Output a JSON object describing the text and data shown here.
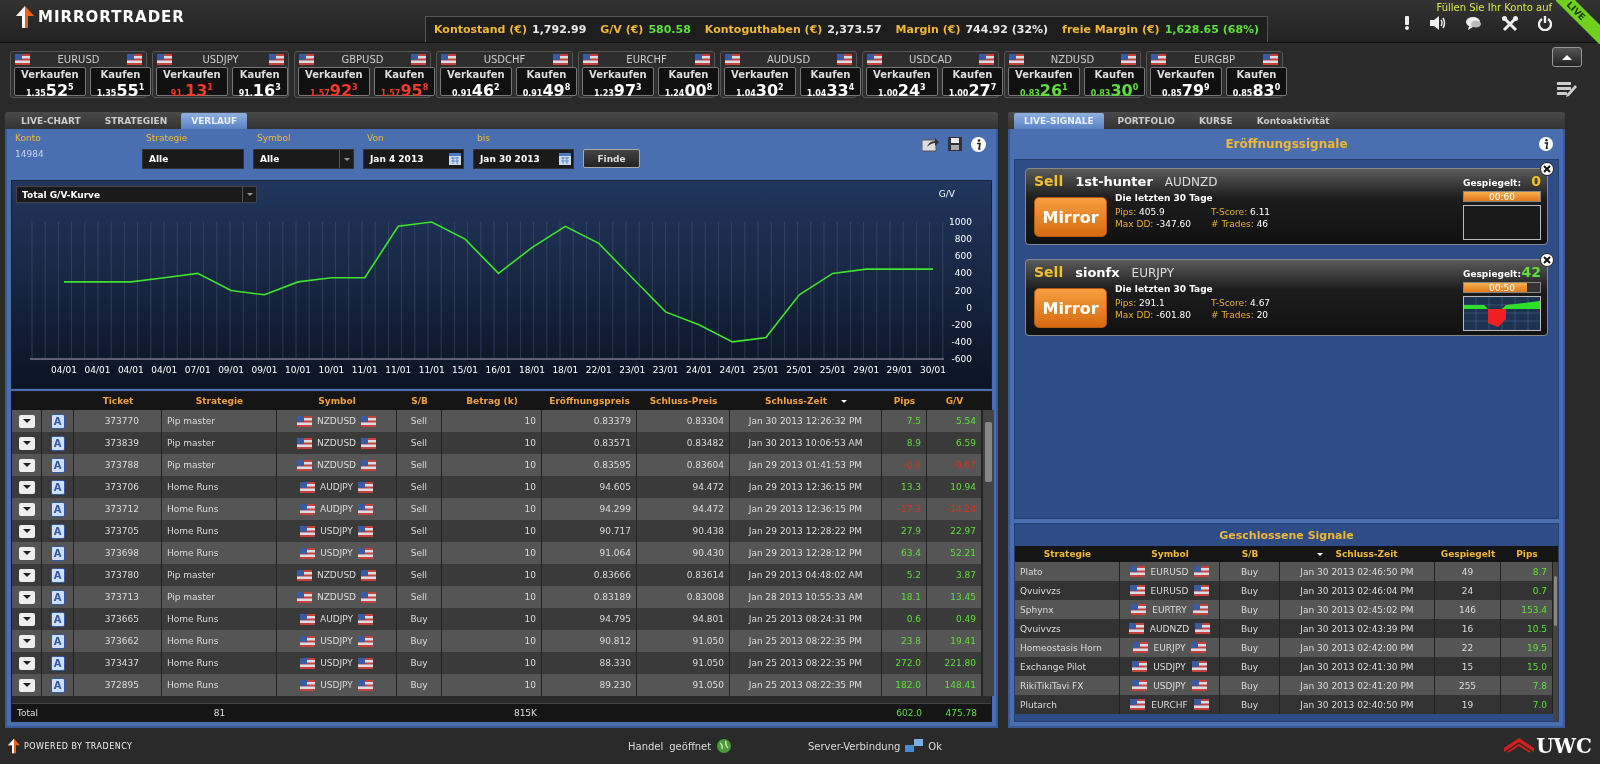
{
  "header": {
    "logo": "MIRRORTRADER",
    "account": [
      {
        "label": "Kontostand (€)",
        "value": "1,792.99",
        "positive": false
      },
      {
        "label": "G/V (€)",
        "value": "580.58",
        "positive": true
      },
      {
        "label": "Kontoguthaben (€)",
        "value": "2,373.57",
        "positive": false
      },
      {
        "label": "Margin (€)",
        "value": "744.92 (32%)",
        "positive": false
      },
      {
        "label": "freie Margin (€)",
        "value": "1,628.65 (68%)",
        "positive": true
      }
    ],
    "topup_link": "Füllen Sie Ihr Konto auf",
    "live_badge": "LIVE"
  },
  "quotes": [
    {
      "symbol": "EURUSD",
      "sell_label": "Verkaufen",
      "buy_label": "Kaufen",
      "sell": {
        "prefix": "1.35",
        "big": "52",
        "pip": "5",
        "color": "#ffffff"
      },
      "buy": {
        "prefix": "1.35",
        "big": "55",
        "pip": "1",
        "color": "#ffffff"
      }
    },
    {
      "symbol": "USDJPY",
      "sell_label": "Verkaufen",
      "buy_label": "Kaufen",
      "sell": {
        "prefix": "91.",
        "big": "13",
        "pip": "1",
        "color": "#f03a2a"
      },
      "buy": {
        "prefix": "91.",
        "big": "16",
        "pip": "3",
        "color": "#ffffff"
      }
    },
    {
      "symbol": "GBPUSD",
      "sell_label": "Verkaufen",
      "buy_label": "Kaufen",
      "sell": {
        "prefix": "1.57",
        "big": "92",
        "pip": "3",
        "color": "#f03a2a"
      },
      "buy": {
        "prefix": "1.57",
        "big": "95",
        "pip": "8",
        "color": "#f03a2a"
      }
    },
    {
      "symbol": "USDCHF",
      "sell_label": "Verkaufen",
      "buy_label": "Kaufen",
      "sell": {
        "prefix": "0.91",
        "big": "46",
        "pip": "2",
        "color": "#ffffff"
      },
      "buy": {
        "prefix": "0.91",
        "big": "49",
        "pip": "8",
        "color": "#ffffff"
      }
    },
    {
      "symbol": "EURCHF",
      "sell_label": "Verkaufen",
      "buy_label": "Kaufen",
      "sell": {
        "prefix": "1.23",
        "big": "97",
        "pip": "3",
        "color": "#ffffff"
      },
      "buy": {
        "prefix": "1.24",
        "big": "00",
        "pip": "8",
        "color": "#ffffff"
      }
    },
    {
      "symbol": "AUDUSD",
      "sell_label": "Verkaufen",
      "buy_label": "Kaufen",
      "sell": {
        "prefix": "1.04",
        "big": "30",
        "pip": "2",
        "color": "#ffffff"
      },
      "buy": {
        "prefix": "1.04",
        "big": "33",
        "pip": "4",
        "color": "#ffffff"
      }
    },
    {
      "symbol": "USDCAD",
      "sell_label": "Verkaufen",
      "buy_label": "Kaufen",
      "sell": {
        "prefix": "1.00",
        "big": "24",
        "pip": "3",
        "color": "#ffffff"
      },
      "buy": {
        "prefix": "1.00",
        "big": "27",
        "pip": "7",
        "color": "#ffffff"
      }
    },
    {
      "symbol": "NZDUSD",
      "sell_label": "Verkaufen",
      "buy_label": "Kaufen",
      "sell": {
        "prefix": "0.83",
        "big": "26",
        "pip": "1",
        "color": "#5de03a"
      },
      "buy": {
        "prefix": "0.83",
        "big": "30",
        "pip": "0",
        "color": "#5de03a"
      }
    },
    {
      "symbol": "EURGBP",
      "sell_label": "Verkaufen",
      "buy_label": "Kaufen",
      "sell": {
        "prefix": "0.85",
        "big": "79",
        "pip": "9",
        "color": "#ffffff"
      },
      "buy": {
        "prefix": "0.85",
        "big": "83",
        "pip": "0",
        "color": "#ffffff"
      }
    }
  ],
  "left_panel": {
    "tabs": [
      {
        "label": "LIVE-CHART",
        "selected": false
      },
      {
        "label": "STRATEGIEN",
        "selected": false
      },
      {
        "label": "VERLAUF",
        "selected": true
      }
    ],
    "filters": {
      "konto_label": "Konto",
      "konto": "14984",
      "strategie_label": "Strategie",
      "strategie": "Alle",
      "symbol_label": "Symbol",
      "symbol": "Alle",
      "von_label": "Von",
      "von": "Jan 4 2013",
      "bis_label": "bis",
      "bis": "Jan 30 2013",
      "find_button": "Finde"
    },
    "chart": {
      "selector": "Total G/V-Kurve",
      "chart_data": {
        "type": "line",
        "ylabel": "G/V",
        "categories": [
          "04/01",
          "04/01",
          "04/01",
          "04/01",
          "07/01",
          "09/01",
          "09/01",
          "10/01",
          "10/01",
          "11/01",
          "11/01",
          "11/01",
          "15/01",
          "16/01",
          "18/01",
          "18/01",
          "22/01",
          "23/01",
          "23/01",
          "24/01",
          "24/01",
          "25/01",
          "25/01",
          "25/01",
          "29/01",
          "29/01",
          "30/01"
        ],
        "series": [
          {
            "color": "#3ee52a",
            "values": [
              300,
              300,
              300,
              350,
              400,
              200,
              150,
              300,
              350,
              350,
              950,
              1000,
              800,
              400,
              700,
              950,
              750,
              350,
              -50,
              -200,
              -400,
              -350,
              150,
              400,
              450,
              450,
              450
            ]
          }
        ],
        "ylim": [
          -600,
          1000
        ],
        "yticks": [
          -600,
          -400,
          -200,
          0,
          200,
          400,
          600,
          800,
          1000
        ],
        "grid": true
      }
    },
    "trades": {
      "columns": [
        "Ticket",
        "Strategie",
        "Symbol",
        "S/B",
        "Betrag (k)",
        "Eröffnungspreis",
        "Schluss-Preis",
        "Schluss-Zeit",
        "Pips",
        "G/V"
      ],
      "rows": [
        {
          "badge": "A",
          "ticket": "373770",
          "strategy": "Pip master",
          "symbol": "NZDUSD",
          "side": "Sell",
          "amount": "10",
          "open": "0.83379",
          "close": "0.83304",
          "time": "Jan 30 2013 12:26:32 PM",
          "pips": "7.5",
          "pl": "5.54",
          "loss": false
        },
        {
          "badge": "A",
          "ticket": "373839",
          "strategy": "Pip master",
          "symbol": "NZDUSD",
          "side": "Sell",
          "amount": "10",
          "open": "0.83571",
          "close": "0.83482",
          "time": "Jan 30 2013 10:06:53 AM",
          "pips": "8.9",
          "pl": "6.59",
          "loss": false
        },
        {
          "badge": "A",
          "ticket": "373788",
          "strategy": "Pip master",
          "symbol": "NZDUSD",
          "side": "Sell",
          "amount": "10",
          "open": "0.83595",
          "close": "0.83604",
          "time": "Jan 29 2013 01:41:53 PM",
          "pips": "-0.9",
          "pl": "-0.67",
          "loss": true
        },
        {
          "badge": "A",
          "ticket": "373706",
          "strategy": "Home Runs",
          "symbol": "AUDJPY",
          "side": "Sell",
          "amount": "10",
          "open": "94.605",
          "close": "94.472",
          "time": "Jan 29 2013 12:36:15 PM",
          "pips": "13.3",
          "pl": "10.94",
          "loss": false
        },
        {
          "badge": "A",
          "ticket": "373712",
          "strategy": "Home Runs",
          "symbol": "AUDJPY",
          "side": "Sell",
          "amount": "10",
          "open": "94.299",
          "close": "94.472",
          "time": "Jan 29 2013 12:36:15 PM",
          "pips": "-17.3",
          "pl": "-14.24",
          "loss": true
        },
        {
          "badge": "A",
          "ticket": "373705",
          "strategy": "Home Runs",
          "symbol": "USDJPY",
          "side": "Sell",
          "amount": "10",
          "open": "90.717",
          "close": "90.438",
          "time": "Jan 29 2013 12:28:22 PM",
          "pips": "27.9",
          "pl": "22.97",
          "loss": false
        },
        {
          "badge": "A",
          "ticket": "373698",
          "strategy": "Home Runs",
          "symbol": "USDJPY",
          "side": "Sell",
          "amount": "10",
          "open": "91.064",
          "close": "90.430",
          "time": "Jan 29 2013 12:28:12 PM",
          "pips": "63.4",
          "pl": "52.21",
          "loss": false
        },
        {
          "badge": "A",
          "ticket": "373780",
          "strategy": "Pip master",
          "symbol": "NZDUSD",
          "side": "Sell",
          "amount": "10",
          "open": "0.83666",
          "close": "0.83614",
          "time": "Jan 29 2013 04:48:02 AM",
          "pips": "5.2",
          "pl": "3.87",
          "loss": false
        },
        {
          "badge": "A",
          "ticket": "373713",
          "strategy": "Pip master",
          "symbol": "NZDUSD",
          "side": "Sell",
          "amount": "10",
          "open": "0.83189",
          "close": "0.83008",
          "time": "Jan 28 2013 10:55:33 AM",
          "pips": "18.1",
          "pl": "13.45",
          "loss": false
        },
        {
          "badge": "A",
          "ticket": "373665",
          "strategy": "Home Runs",
          "symbol": "AUDJPY",
          "side": "Buy",
          "amount": "10",
          "open": "94.795",
          "close": "94.801",
          "time": "Jan 25 2013 08:24:31 PM",
          "pips": "0.6",
          "pl": "0.49",
          "loss": false
        },
        {
          "badge": "A",
          "ticket": "373662",
          "strategy": "Home Runs",
          "symbol": "USDJPY",
          "side": "Buy",
          "amount": "10",
          "open": "90.812",
          "close": "91.050",
          "time": "Jan 25 2013 08:22:35 PM",
          "pips": "23.8",
          "pl": "19.41",
          "loss": false
        },
        {
          "badge": "A",
          "ticket": "373437",
          "strategy": "Home Runs",
          "symbol": "USDJPY",
          "side": "Buy",
          "amount": "10",
          "open": "88.330",
          "close": "91.050",
          "time": "Jan 25 2013 08:22:35 PM",
          "pips": "272.0",
          "pl": "221.80",
          "loss": false
        },
        {
          "badge": "A",
          "ticket": "372895",
          "strategy": "Home Runs",
          "symbol": "USDJPY",
          "side": "Buy",
          "amount": "10",
          "open": "89.230",
          "close": "91.050",
          "time": "Jan 25 2013 08:22:35 PM",
          "pips": "182.0",
          "pl": "148.41",
          "loss": false
        }
      ],
      "totals": {
        "label": "Total",
        "count": "81",
        "amount": "815K",
        "pips": "602.0",
        "pl": "475.78"
      }
    }
  },
  "right_panel": {
    "tabs": [
      {
        "label": "LIVE-SIGNALE",
        "selected": true
      },
      {
        "label": "PORTFOLIO",
        "selected": false
      },
      {
        "label": "KURSE",
        "selected": false
      },
      {
        "label": "Kontoaktivität",
        "selected": false
      }
    ],
    "open_title": "Eröffnungssignale",
    "signals": [
      {
        "side": "Sell",
        "strategy": "1st-hunter",
        "symbol": "AUDNZD",
        "mirror_button": "Mirror",
        "period": "Die letzten 30 Tage",
        "stats": [
          {
            "label": "Pips:",
            "value": "405.9"
          },
          {
            "label": "T-Score:",
            "value": "6.11"
          },
          {
            "label": "Max DD:",
            "value": "-347.60"
          },
          {
            "label": "# Trades:",
            "value": "46"
          }
        ],
        "mirrored_label": "Gespiegelt:",
        "mirrored_count": "0",
        "active": false,
        "timer": "00:60",
        "level": 1.0,
        "sparkline": false
      },
      {
        "side": "Sell",
        "strategy": "sionfx",
        "symbol": "EURJPY",
        "mirror_button": "Mirror",
        "period": "Die letzten 30 Tage",
        "stats": [
          {
            "label": "Pips:",
            "value": "291.1"
          },
          {
            "label": "T-Score:",
            "value": "4.67"
          },
          {
            "label": "Max DD:",
            "value": "-601.80"
          },
          {
            "label": "# Trades:",
            "value": "20"
          }
        ],
        "mirrored_label": "Gespiegelt:",
        "mirrored_count": "42",
        "active": true,
        "timer": "00:50",
        "level": 0.83,
        "sparkline": true
      }
    ],
    "closed_title": "Geschlossene Signale",
    "closed": {
      "columns": [
        "Strategie",
        "Symbol",
        "S/B",
        "Schluss-Zeit",
        "Gespiegelt",
        "Pips"
      ],
      "rows": [
        {
          "strategy": "Plato",
          "symbol": "EURUSD",
          "side": "Buy",
          "time": "Jan 30 2013 02:46:50 PM",
          "mirrored": "49",
          "pips": "8.7"
        },
        {
          "strategy": "Qvuivvzs",
          "symbol": "EURUSD",
          "side": "Buy",
          "time": "Jan 30 2013 02:46:04 PM",
          "mirrored": "24",
          "pips": "0.7"
        },
        {
          "strategy": "Sphynx",
          "symbol": "EURTRY",
          "side": "Buy",
          "time": "Jan 30 2013 02:45:02 PM",
          "mirrored": "146",
          "pips": "153.4"
        },
        {
          "strategy": "Qvuivvzs",
          "symbol": "AUDNZD",
          "side": "Buy",
          "time": "Jan 30 2013 02:43:39 PM",
          "mirrored": "16",
          "pips": "10.5"
        },
        {
          "strategy": "Homeostasis Horn",
          "symbol": "EURJPY",
          "side": "Buy",
          "time": "Jan 30 2013 02:42:00 PM",
          "mirrored": "22",
          "pips": "19.5"
        },
        {
          "strategy": "Exchange Pilot",
          "symbol": "USDJPY",
          "side": "Buy",
          "time": "Jan 30 2013 02:41:30 PM",
          "mirrored": "15",
          "pips": "15.0"
        },
        {
          "strategy": "RikiTikiTavi FX",
          "symbol": "USDJPY",
          "side": "Buy",
          "time": "Jan 30 2013 02:41:20 PM",
          "mirrored": "255",
          "pips": "7.8"
        },
        {
          "strategy": "Plutarch",
          "symbol": "EURCHF",
          "side": "Buy",
          "time": "Jan 30 2013 02:40:50 PM",
          "mirrored": "19",
          "pips": "7.0"
        }
      ]
    }
  },
  "footer": {
    "powered": "POWERED BY TRADENCY",
    "trading_label": "Handel",
    "trading_state": "geöffnet",
    "server_label": "Server-Verbindung",
    "server_state": "Ok",
    "brand": "UWC"
  }
}
